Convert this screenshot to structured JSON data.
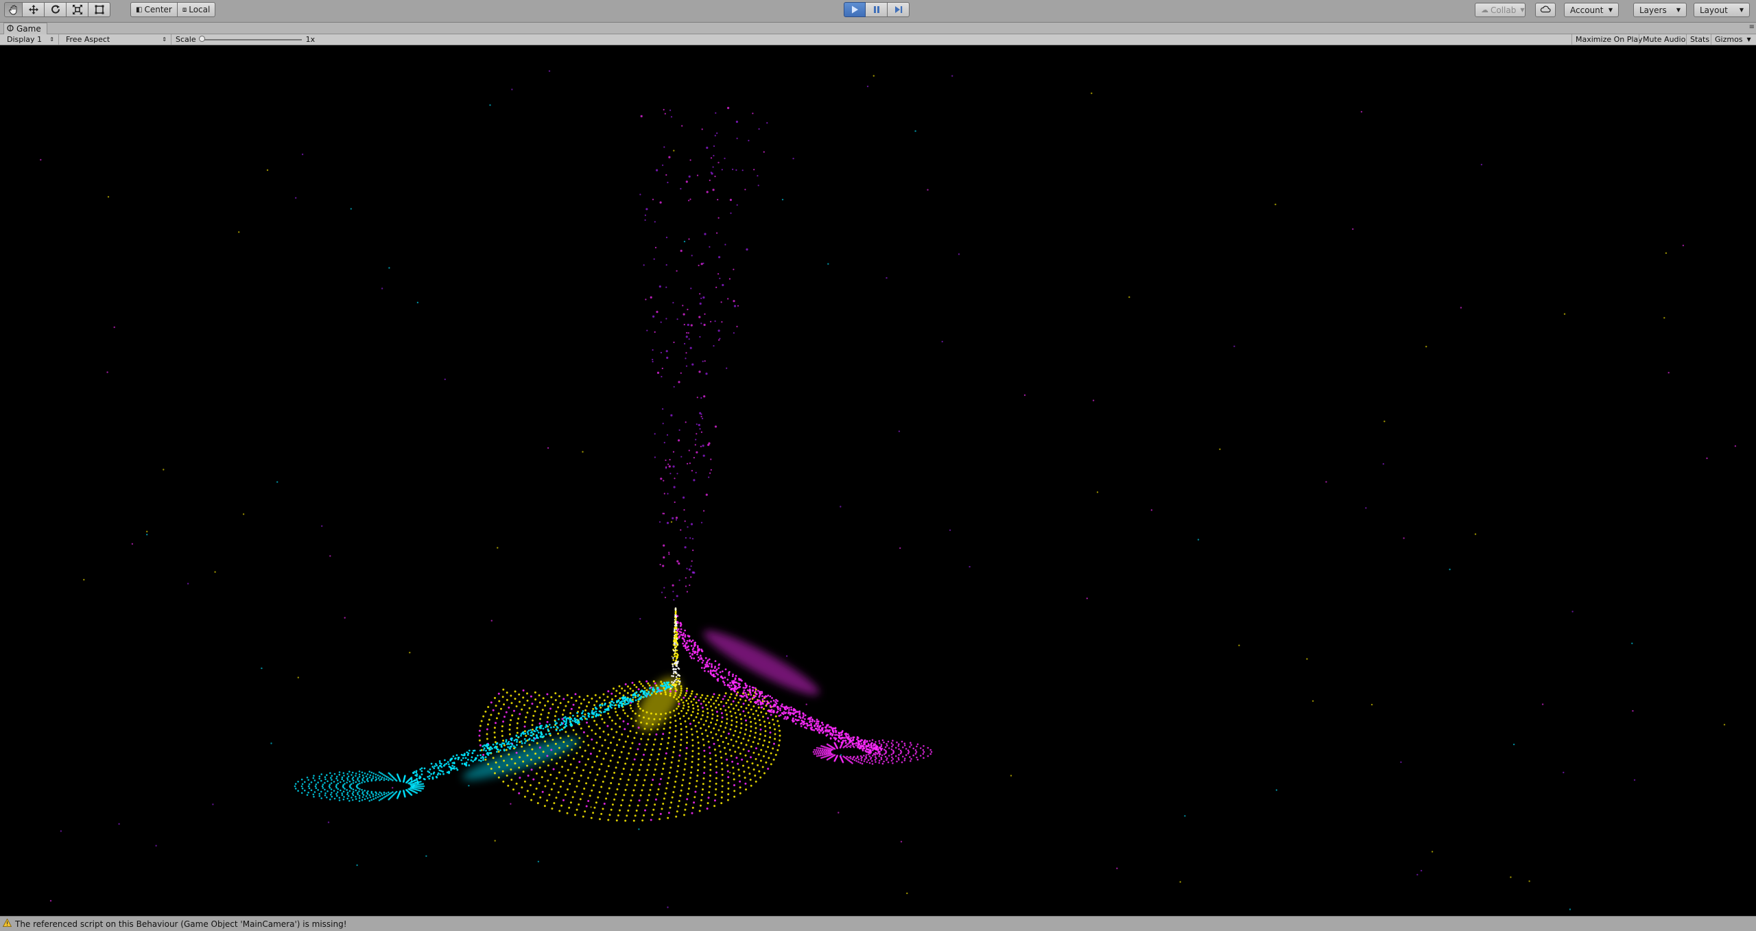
{
  "toolbar": {
    "tools": [
      {
        "name": "hand-tool",
        "icon": "hand-icon",
        "active": true
      },
      {
        "name": "move-tool",
        "icon": "move-icon"
      },
      {
        "name": "rotate-tool",
        "icon": "rotate-icon"
      },
      {
        "name": "scale-tool",
        "icon": "scale-icon"
      },
      {
        "name": "rect-tool",
        "icon": "rect-transform-icon"
      }
    ],
    "pivot_label": "Center",
    "space_label": "Local",
    "play_controls": [
      {
        "name": "play",
        "icon": "play-icon",
        "active": true
      },
      {
        "name": "pause",
        "icon": "pause-icon"
      },
      {
        "name": "step",
        "icon": "step-icon"
      }
    ],
    "collab_label": "Collab",
    "account_label": "Account",
    "layers_label": "Layers",
    "layout_label": "Layout",
    "accent_color": "#3f6fb9"
  },
  "tab": {
    "title": "Game",
    "icon": "game-controller-icon"
  },
  "game_toolbar": {
    "display": "Display 1",
    "aspect": "Free Aspect",
    "scale_label": "Scale",
    "scale_value": "1x",
    "maximize_on_play": "Maximize On Play",
    "mute_audio": "Mute Audio",
    "stats": "Stats",
    "gizmos": "Gizmos"
  },
  "viewport": {
    "background": "#000000",
    "particle_colors": [
      "#00e5ff",
      "#ffee00",
      "#ff2bff",
      "#a020f0"
    ]
  },
  "status": {
    "icon": "warning-icon",
    "message": "The referenced script on this Behaviour (Game Object 'MainCamera') is missing!"
  }
}
